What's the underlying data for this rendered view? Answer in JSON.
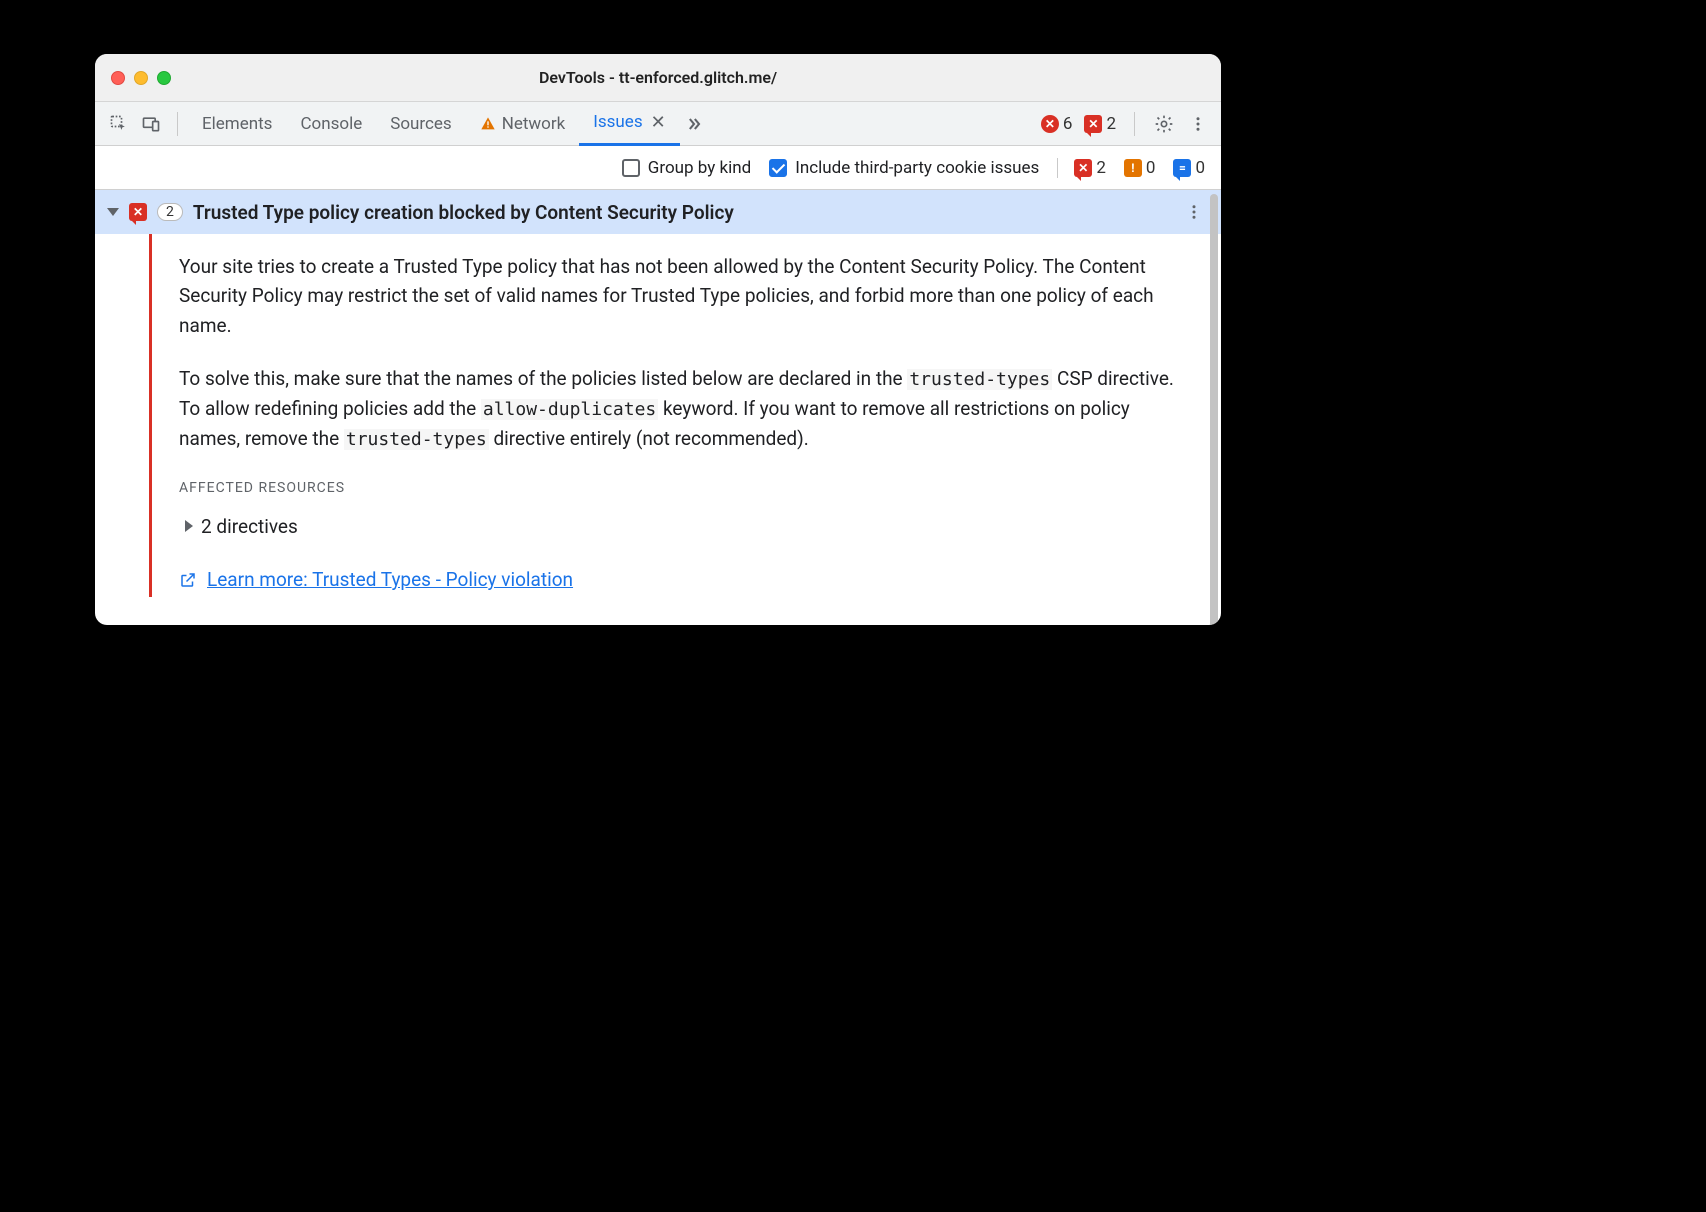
{
  "window": {
    "title": "DevTools - tt-enforced.glitch.me/"
  },
  "tabs": {
    "elements": "Elements",
    "console": "Console",
    "sources": "Sources",
    "network": "Network",
    "issues": "Issues"
  },
  "topCounts": {
    "errors": "6",
    "issueErrors": "2"
  },
  "filters": {
    "groupByKind": "Group by kind",
    "thirdParty": "Include third-party cookie issues"
  },
  "filterCounts": {
    "errors": "2",
    "warnings": "0",
    "info": "0"
  },
  "issue": {
    "count": "2",
    "title": "Trusted Type policy creation blocked by Content Security Policy",
    "p1": "Your site tries to create a Trusted Type policy that has not been allowed by the Content Security Policy. The Content Security Policy may restrict the set of valid names for Trusted Type policies, and forbid more than one policy of each name.",
    "p2a": "To solve this, make sure that the names of the policies listed below are declared in the ",
    "p2code1": "trusted-types",
    "p2b": " CSP directive. To allow redefining policies add the ",
    "p2code2": "allow-duplicates",
    "p2c": " keyword. If you want to remove all restrictions on policy names, remove the ",
    "p2code3": "trusted-types",
    "p2d": " directive entirely (not recommended).",
    "affectedLabel": "AFFECTED RESOURCES",
    "directives": "2 directives",
    "learnMore": "Learn more: Trusted Types - Policy violation"
  }
}
